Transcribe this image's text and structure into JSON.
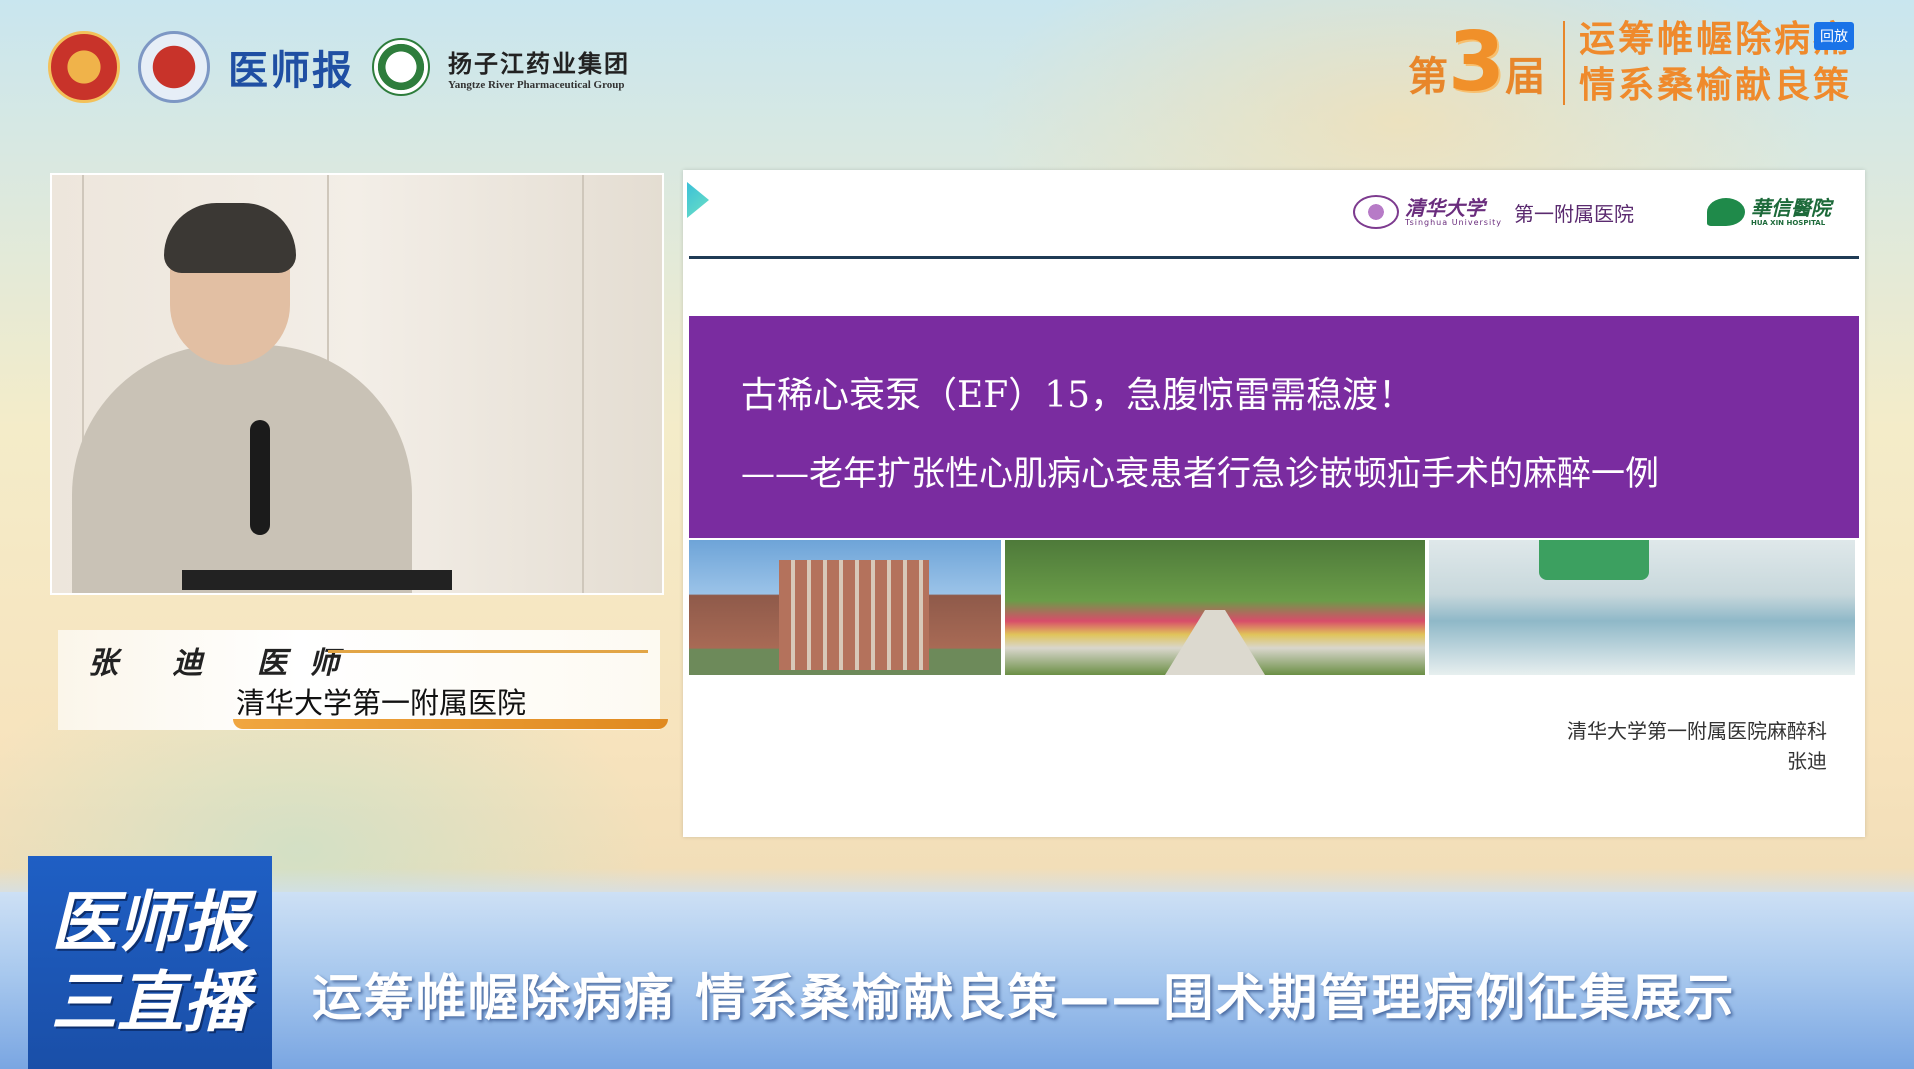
{
  "badge": {
    "replay": "回放"
  },
  "sponsors": {
    "yishibao": "医师报",
    "yangtze_cn": "扬子江药业集团",
    "yangtze_en": "Yangtze River Pharmaceutical Group"
  },
  "event": {
    "edition_prefix": "第",
    "edition_number": "3",
    "edition_suffix": "届",
    "line1": "运筹帷幄除病痛",
    "line2": "情系桑榆献良策"
  },
  "speaker": {
    "name": "张 迪 医师",
    "affiliation": "清华大学第一附属医院"
  },
  "slide": {
    "logo_tsinghua_cn": "清华大学",
    "logo_tsinghua_en": "Tsinghua University",
    "logo_tsinghua_hospital": "第一附属医院",
    "logo_huaxin_cn": "華信醫院",
    "logo_huaxin_en": "HUA XIN HOSPITAL",
    "title": "古稀心衰泵（EF）15，急腹惊雷需稳渡！",
    "subtitle": "——老年扩张性心肌病心衰患者行急诊嵌顿疝手术的麻醉一例",
    "footer_dept": "清华大学第一附属医院麻醉科",
    "footer_author": "张迪"
  },
  "banner": {
    "logo_line1": "医师报",
    "logo_line2": "三直播",
    "title": "运筹帷幄除病痛  情系桑榆献良策——围术期管理病例征集展示"
  }
}
